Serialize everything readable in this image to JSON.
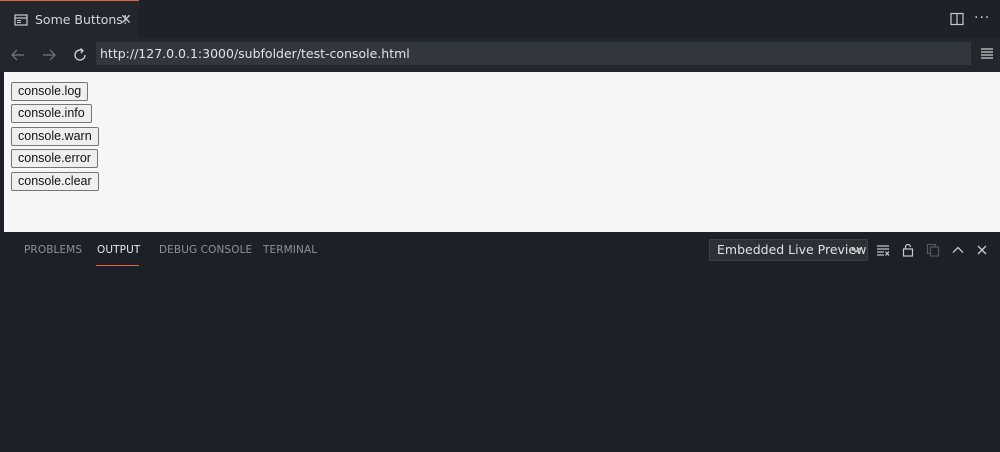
{
  "tab": {
    "title": "Some Buttons!",
    "icon": "preview-tab-icon",
    "close_glyph": "✕"
  },
  "toolbar": {
    "more_glyph": "···"
  },
  "nav": {
    "url": "http://127.0.0.1:3000/subfolder/test-console.html"
  },
  "preview": {
    "buttons": [
      "console.log",
      "console.info",
      "console.warn",
      "console.error",
      "console.clear"
    ]
  },
  "panel": {
    "tabs": [
      "PROBLEMS",
      "OUTPUT",
      "DEBUG CONSOLE",
      "TERMINAL"
    ],
    "active_tab": "OUTPUT",
    "dropdown_value": "Embedded Live Preview"
  },
  "colors": {
    "accent": "#e4683f",
    "background": "#1d2027",
    "preview_bg": "#f6f6f7"
  }
}
